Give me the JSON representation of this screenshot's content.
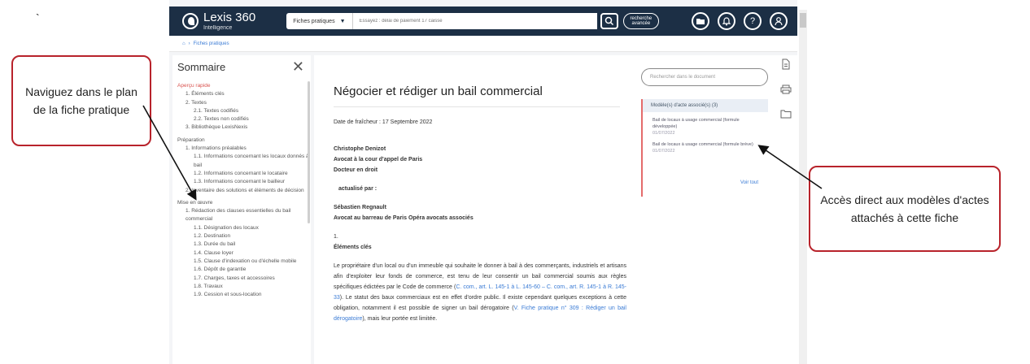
{
  "stray_mark": "`",
  "app": {
    "logo_title": "Lexis 360",
    "logo_sub": "Intelligence",
    "search_scope": "Fiches pratiques",
    "search_placeholder": "Essayez : délai de paiement 17 caisse",
    "advanced_search_line1": "recherche",
    "advanced_search_line2": "avancée",
    "breadcrumb": "Fiches pratiques"
  },
  "sidebar": {
    "title": "Sommaire",
    "sections": [
      {
        "label": "Aperçu rapide",
        "active": true,
        "items": [
          {
            "level": 1,
            "label": "1. Éléments clés"
          },
          {
            "level": 1,
            "label": "2. Textes"
          },
          {
            "level": 2,
            "label": "2.1. Textes codifiés"
          },
          {
            "level": 2,
            "label": "2.2. Textes non codifiés"
          },
          {
            "level": 1,
            "label": "3. Bibliothèque LexisNexis"
          }
        ]
      },
      {
        "label": "Préparation",
        "active": false,
        "items": [
          {
            "level": 1,
            "label": "1. Informations préalables"
          },
          {
            "level": 2,
            "label": "1.1. Informations concernant les locaux donnés à bail"
          },
          {
            "level": 2,
            "label": "1.2. Informations concernant le locataire"
          },
          {
            "level": 2,
            "label": "1.3. Informations concernant le bailleur"
          },
          {
            "level": 1,
            "label": "2. Inventaire des solutions et éléments de décision"
          }
        ]
      },
      {
        "label": "Mise en œuvre",
        "active": false,
        "items": [
          {
            "level": 1,
            "label": "1. Rédaction des clauses essentielles du bail commercial"
          },
          {
            "level": 2,
            "label": "1.1. Désignation des locaux"
          },
          {
            "level": 2,
            "label": "1.2. Destination"
          },
          {
            "level": 2,
            "label": "1.3. Durée du bail"
          },
          {
            "level": 2,
            "label": "1.4. Clause loyer"
          },
          {
            "level": 2,
            "label": "1.5. Clause d'indexation ou d'échelle mobile"
          },
          {
            "level": 2,
            "label": "1.6. Dépôt de garantie"
          },
          {
            "level": 2,
            "label": "1.7. Charges, taxes et accessoires"
          },
          {
            "level": 2,
            "label": "1.8. Travaux"
          },
          {
            "level": 2,
            "label": "1.9. Cession et sous-location"
          }
        ]
      }
    ]
  },
  "document": {
    "title": "Négocier et rédiger un bail commercial",
    "freshness": "Date de fraîcheur : 17 Septembre 2022",
    "author_name": "Christophe Denizot",
    "author_role1": "Avocat à la cour d'appel de Paris",
    "author_role2": "Docteur en droit",
    "updated_by": "actualisé par :",
    "updater_name": "Sébastien Regnault",
    "updater_role": "Avocat au barreau de Paris Opéra avocats associés",
    "section_number": "1.",
    "section_title": "Éléments clés",
    "para_part1": "Le propriétaire d'un local ou d'un immeuble qui souhaite le donner à bail à des commerçants, industriels et artisans afin d'exploiter leur fonds de commerce, est tenu de leur consentir un bail commercial soumis aux règles spécifiques édictées par le Code de commerce (",
    "para_link1": "C. com., art. L. 145-1 à L. 145-60 – C. com., art. R. 145-1 à R. 145-33",
    "para_part2": "). Le statut des baux commerciaux est en effet d'ordre public. Il existe cependant quelques exceptions à cette obligation, notamment il est possible de signer un bail dérogatoire (",
    "para_link2": "V. Fiche pratique n° 309 : Rédiger un bail dérogatoire",
    "para_part3": "), mais leur portée est limitée."
  },
  "right_panel": {
    "search_placeholder": "Rechercher dans le document",
    "models_header": "Modèle(s) d'acte associé(s) (3)",
    "models": [
      {
        "title": "Bail de locaux à usage commercial (formule développée)",
        "date": "01/07/2022"
      },
      {
        "title": "Bail de locaux à usage commercial (formule brève)",
        "date": "01/07/2022"
      }
    ],
    "see_all": "Voir tout"
  },
  "callouts": {
    "left": "Naviguez dans le plan de la fiche pratique",
    "right": "Accès direct aux modèles d'actes attachés à cette fiche"
  },
  "colors": {
    "topbar": "#1c2f45",
    "callout_border": "#b8232b",
    "active_section": "#d9534f",
    "link": "#3a7bd5"
  }
}
